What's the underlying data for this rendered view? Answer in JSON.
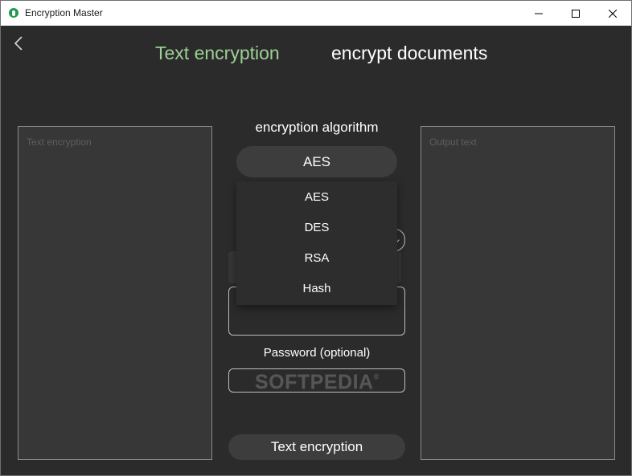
{
  "window": {
    "title": "Encryption Master",
    "icons": {
      "app": "app-icon",
      "minimize": "minimize-icon",
      "maximize": "maximize-icon",
      "close": "close-icon"
    }
  },
  "header": {
    "back_icon": "chevron-left-icon",
    "tabs": [
      {
        "label": "Text encryption",
        "active": true,
        "color": "#9ccf95"
      },
      {
        "label": "encrypt documents",
        "active": false,
        "color": "#ffffff"
      }
    ]
  },
  "input_panel": {
    "placeholder": "Text encryption"
  },
  "output_panel": {
    "placeholder": "Output text"
  },
  "algorithm": {
    "label": "encryption algorithm",
    "selected": "AES",
    "options": [
      "AES",
      "DES",
      "RSA",
      "Hash"
    ]
  },
  "password": {
    "label": "Password (optional)"
  },
  "watermark": {
    "text": "SOFTPEDIA",
    "mark": "®"
  },
  "action": {
    "label": "Text encryption"
  },
  "colors": {
    "background": "#2b2b2b",
    "accent": "#9ccf95",
    "control": "#3d3d3d"
  }
}
